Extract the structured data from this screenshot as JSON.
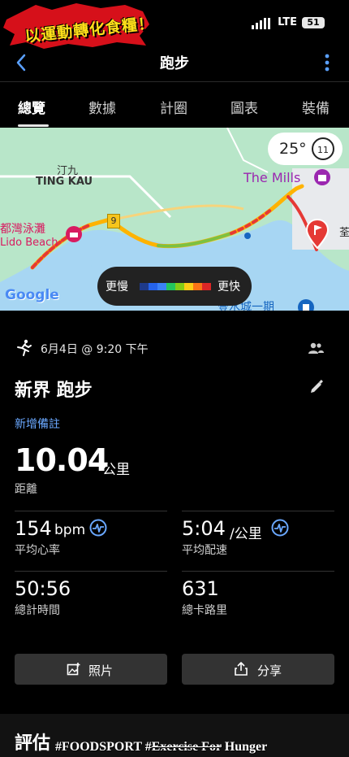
{
  "status_bar": {
    "logo_text": "以運動轉化食糧！",
    "network": "LTE",
    "battery": "51"
  },
  "header": {
    "title": "跑步"
  },
  "tabs": [
    {
      "label": "總覽",
      "active": true
    },
    {
      "label": "數據",
      "active": false
    },
    {
      "label": "計圈",
      "active": false
    },
    {
      "label": "圖表",
      "active": false
    },
    {
      "label": "裝備",
      "active": false
    }
  ],
  "map": {
    "labels": {
      "tingkau_cn": "汀九",
      "tingkau_en": "TING KAU",
      "beach_cn": "都灣泳灘",
      "beach_en": "Lido Beach",
      "mills": "The Mills",
      "road_number": "9",
      "tsuen": "荃",
      "google": "Google",
      "bottom_text": "壹水城一期"
    },
    "weather": {
      "temperature": "25°",
      "wind": "11"
    },
    "legend": {
      "slow": "更慢",
      "fast": "更快"
    },
    "colors": {
      "water": "#a7d6f3",
      "land": "#b8e6c9",
      "route_slow": "#e53935",
      "route_fast": "#7cc142",
      "marker": "#e53935"
    }
  },
  "activity": {
    "datetime": "6月4日 @ 9:20 下午",
    "name": "新界 跑步",
    "add_note": "新增備註"
  },
  "stats": {
    "distance": {
      "value": "10.04",
      "unit": "公里",
      "label": "距離"
    },
    "avg_hr": {
      "value": "154",
      "unit": "bpm",
      "label": "平均心率"
    },
    "avg_pace": {
      "value": "5:04",
      "unit": "/公里",
      "label": "平均配速"
    },
    "total_time": {
      "value": "50:56",
      "label": "總計時間"
    },
    "calories": {
      "value": "631",
      "label": "總卡路里"
    }
  },
  "buttons": {
    "photos": "照片",
    "share": "分享"
  },
  "section": {
    "title": "評估"
  },
  "watermark": {
    "part1": "#FOODSPORT #",
    "part2": "Exercise For",
    "part3": " Hunger"
  },
  "accent_color": "#6aa8ff"
}
